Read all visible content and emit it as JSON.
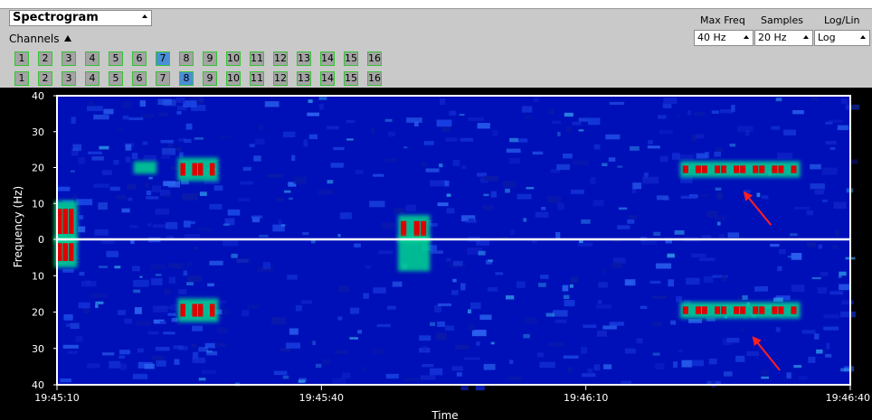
{
  "toolbar": {
    "view_select": "Spectrogram",
    "channels_label": "Channels",
    "max_freq_label": "Max Freq",
    "samples_label": "Samples",
    "scale_label": "Log/Lin",
    "max_freq_value": "40 Hz",
    "samples_value": "20 Hz",
    "scale_value": "Log"
  },
  "channels": {
    "row1": [
      "1",
      "2",
      "3",
      "4",
      "5",
      "6",
      "7",
      "8",
      "9",
      "10",
      "11",
      "12",
      "13",
      "14",
      "15",
      "16"
    ],
    "row2": [
      "1",
      "2",
      "3",
      "4",
      "5",
      "6",
      "7",
      "8",
      "9",
      "10",
      "11",
      "12",
      "13",
      "14",
      "15",
      "16"
    ],
    "row1_selected": "7",
    "row2_selected": "8"
  },
  "colors": {
    "background": "#0010b8",
    "hot": "#e00000",
    "warm": "#00d890",
    "axis": "#ffffff"
  },
  "chart_data": {
    "type": "heatmap",
    "xlabel": "Time",
    "ylabel": "Frequency (Hz)",
    "x_ticks": [
      "19:45:10",
      "19:45:40",
      "19:46:10",
      "19:46:40"
    ],
    "y_ticks_top": [
      "40",
      "30",
      "20",
      "10",
      "0"
    ],
    "y_ticks_bottom": [
      "10",
      "20",
      "30",
      "40"
    ],
    "xlim": [
      "19:45:10",
      "19:46:40"
    ],
    "ylim_top": [
      0,
      40
    ],
    "ylim_bottom": [
      0,
      40
    ],
    "bands": [
      {
        "half": "top",
        "t_start": 0,
        "t_end": 2,
        "f_low": 0,
        "f_high": 10,
        "level": "high"
      },
      {
        "half": "top",
        "t_start": 9,
        "t_end": 11,
        "f_low": 19,
        "f_high": 21,
        "level": "mid"
      },
      {
        "half": "top",
        "t_start": 14,
        "t_end": 18,
        "f_low": 17,
        "f_high": 22,
        "level": "high"
      },
      {
        "half": "top",
        "t_start": 39,
        "t_end": 42,
        "f_low": 0,
        "f_high": 6,
        "level": "high"
      },
      {
        "half": "top",
        "t_start": 71,
        "t_end": 84,
        "f_low": 18,
        "f_high": 21,
        "level": "high"
      },
      {
        "half": "bottom",
        "t_start": 0,
        "t_end": 2,
        "f_low": 0,
        "f_high": 7,
        "level": "high"
      },
      {
        "half": "bottom",
        "t_start": 14,
        "t_end": 18,
        "f_low": 17,
        "f_high": 22,
        "level": "high"
      },
      {
        "half": "bottom",
        "t_start": 39,
        "t_end": 42,
        "f_low": 0,
        "f_high": 8,
        "level": "mid"
      },
      {
        "half": "bottom",
        "t_start": 71,
        "t_end": 84,
        "f_low": 18,
        "f_high": 21,
        "level": "high"
      }
    ],
    "annotations": [
      {
        "type": "arrow",
        "color": "#ff2020",
        "half": "top",
        "t_from": 81,
        "f_from": 4,
        "t_to": 78,
        "f_to": 13
      },
      {
        "type": "arrow",
        "color": "#ff2020",
        "half": "bottom",
        "t_from": 82,
        "f_from": 36,
        "t_to": 79,
        "f_to": 27
      }
    ]
  }
}
